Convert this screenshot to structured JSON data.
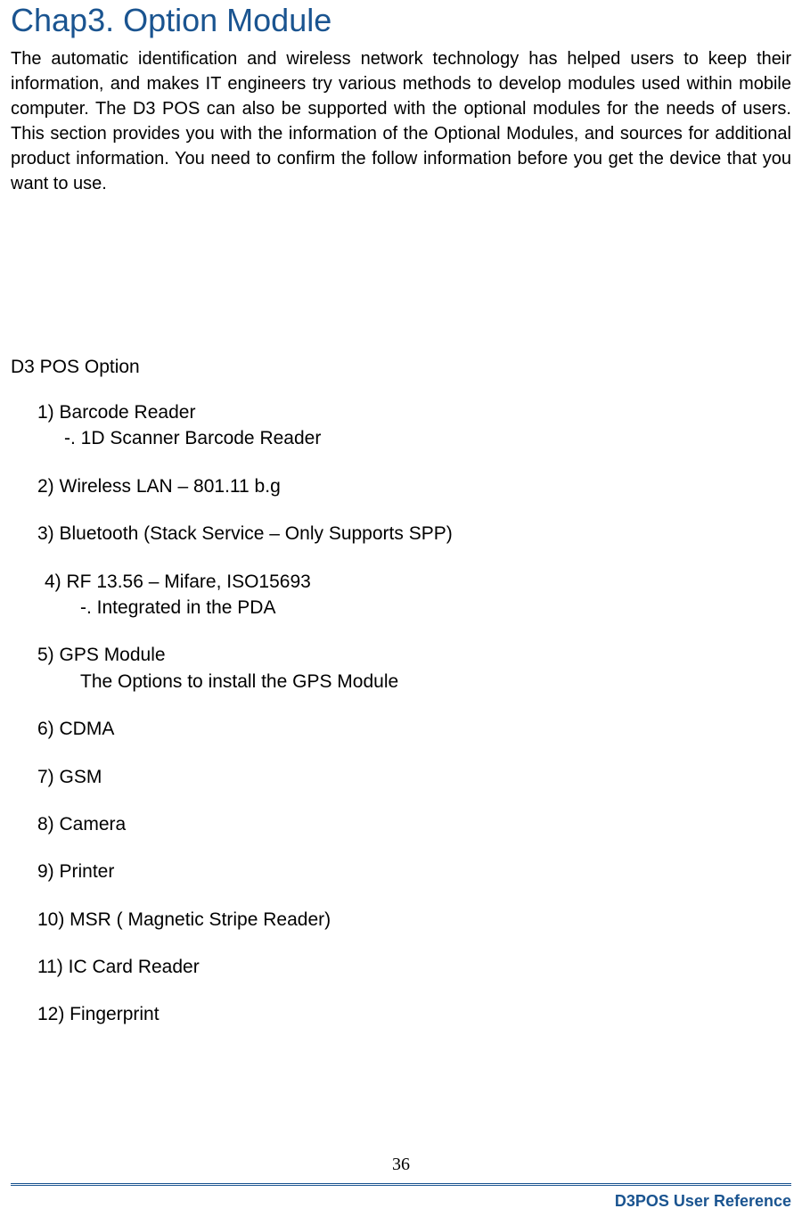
{
  "chapter": {
    "title": "Chap3. Option Module",
    "intro": "The automatic identification and wireless network technology has helped users to keep their information, and makes IT engineers try various methods to develop modules used within mobile computer. The D3 POS can also be supported with the optional modules for the needs of users. This section provides you with the information of the Optional Modules, and sources for additional product information. You need to confirm the follow information before you get the device that you want to use."
  },
  "section": {
    "title": "D3 POS Option",
    "options": {
      "opt1": "1) Barcode Reader",
      "opt1_sub": "-. 1D Scanner Barcode Reader",
      "opt2": "2) Wireless LAN –  801.11 b.g",
      "opt3": "3) Bluetooth (Stack Service –  Only Supports SPP)",
      "opt4": "4) RF 13.56   –   Mifare, ISO15693",
      "opt4_sub": "-. Integrated in the PDA",
      "opt5": "5) GPS Module",
      "opt5_sub": "The Options to install the GPS Module",
      "opt6": "6) CDMA",
      "opt7": "7) GSM",
      "opt8": "8) Camera",
      "opt9": "9) Printer",
      "opt10": "10) MSR ( Magnetic Stripe Reader)",
      "opt11": "11) IC Card Reader",
      "opt12": "12) Fingerprint"
    }
  },
  "footer": {
    "page_number": "36",
    "reference": "D3POS User Reference"
  }
}
